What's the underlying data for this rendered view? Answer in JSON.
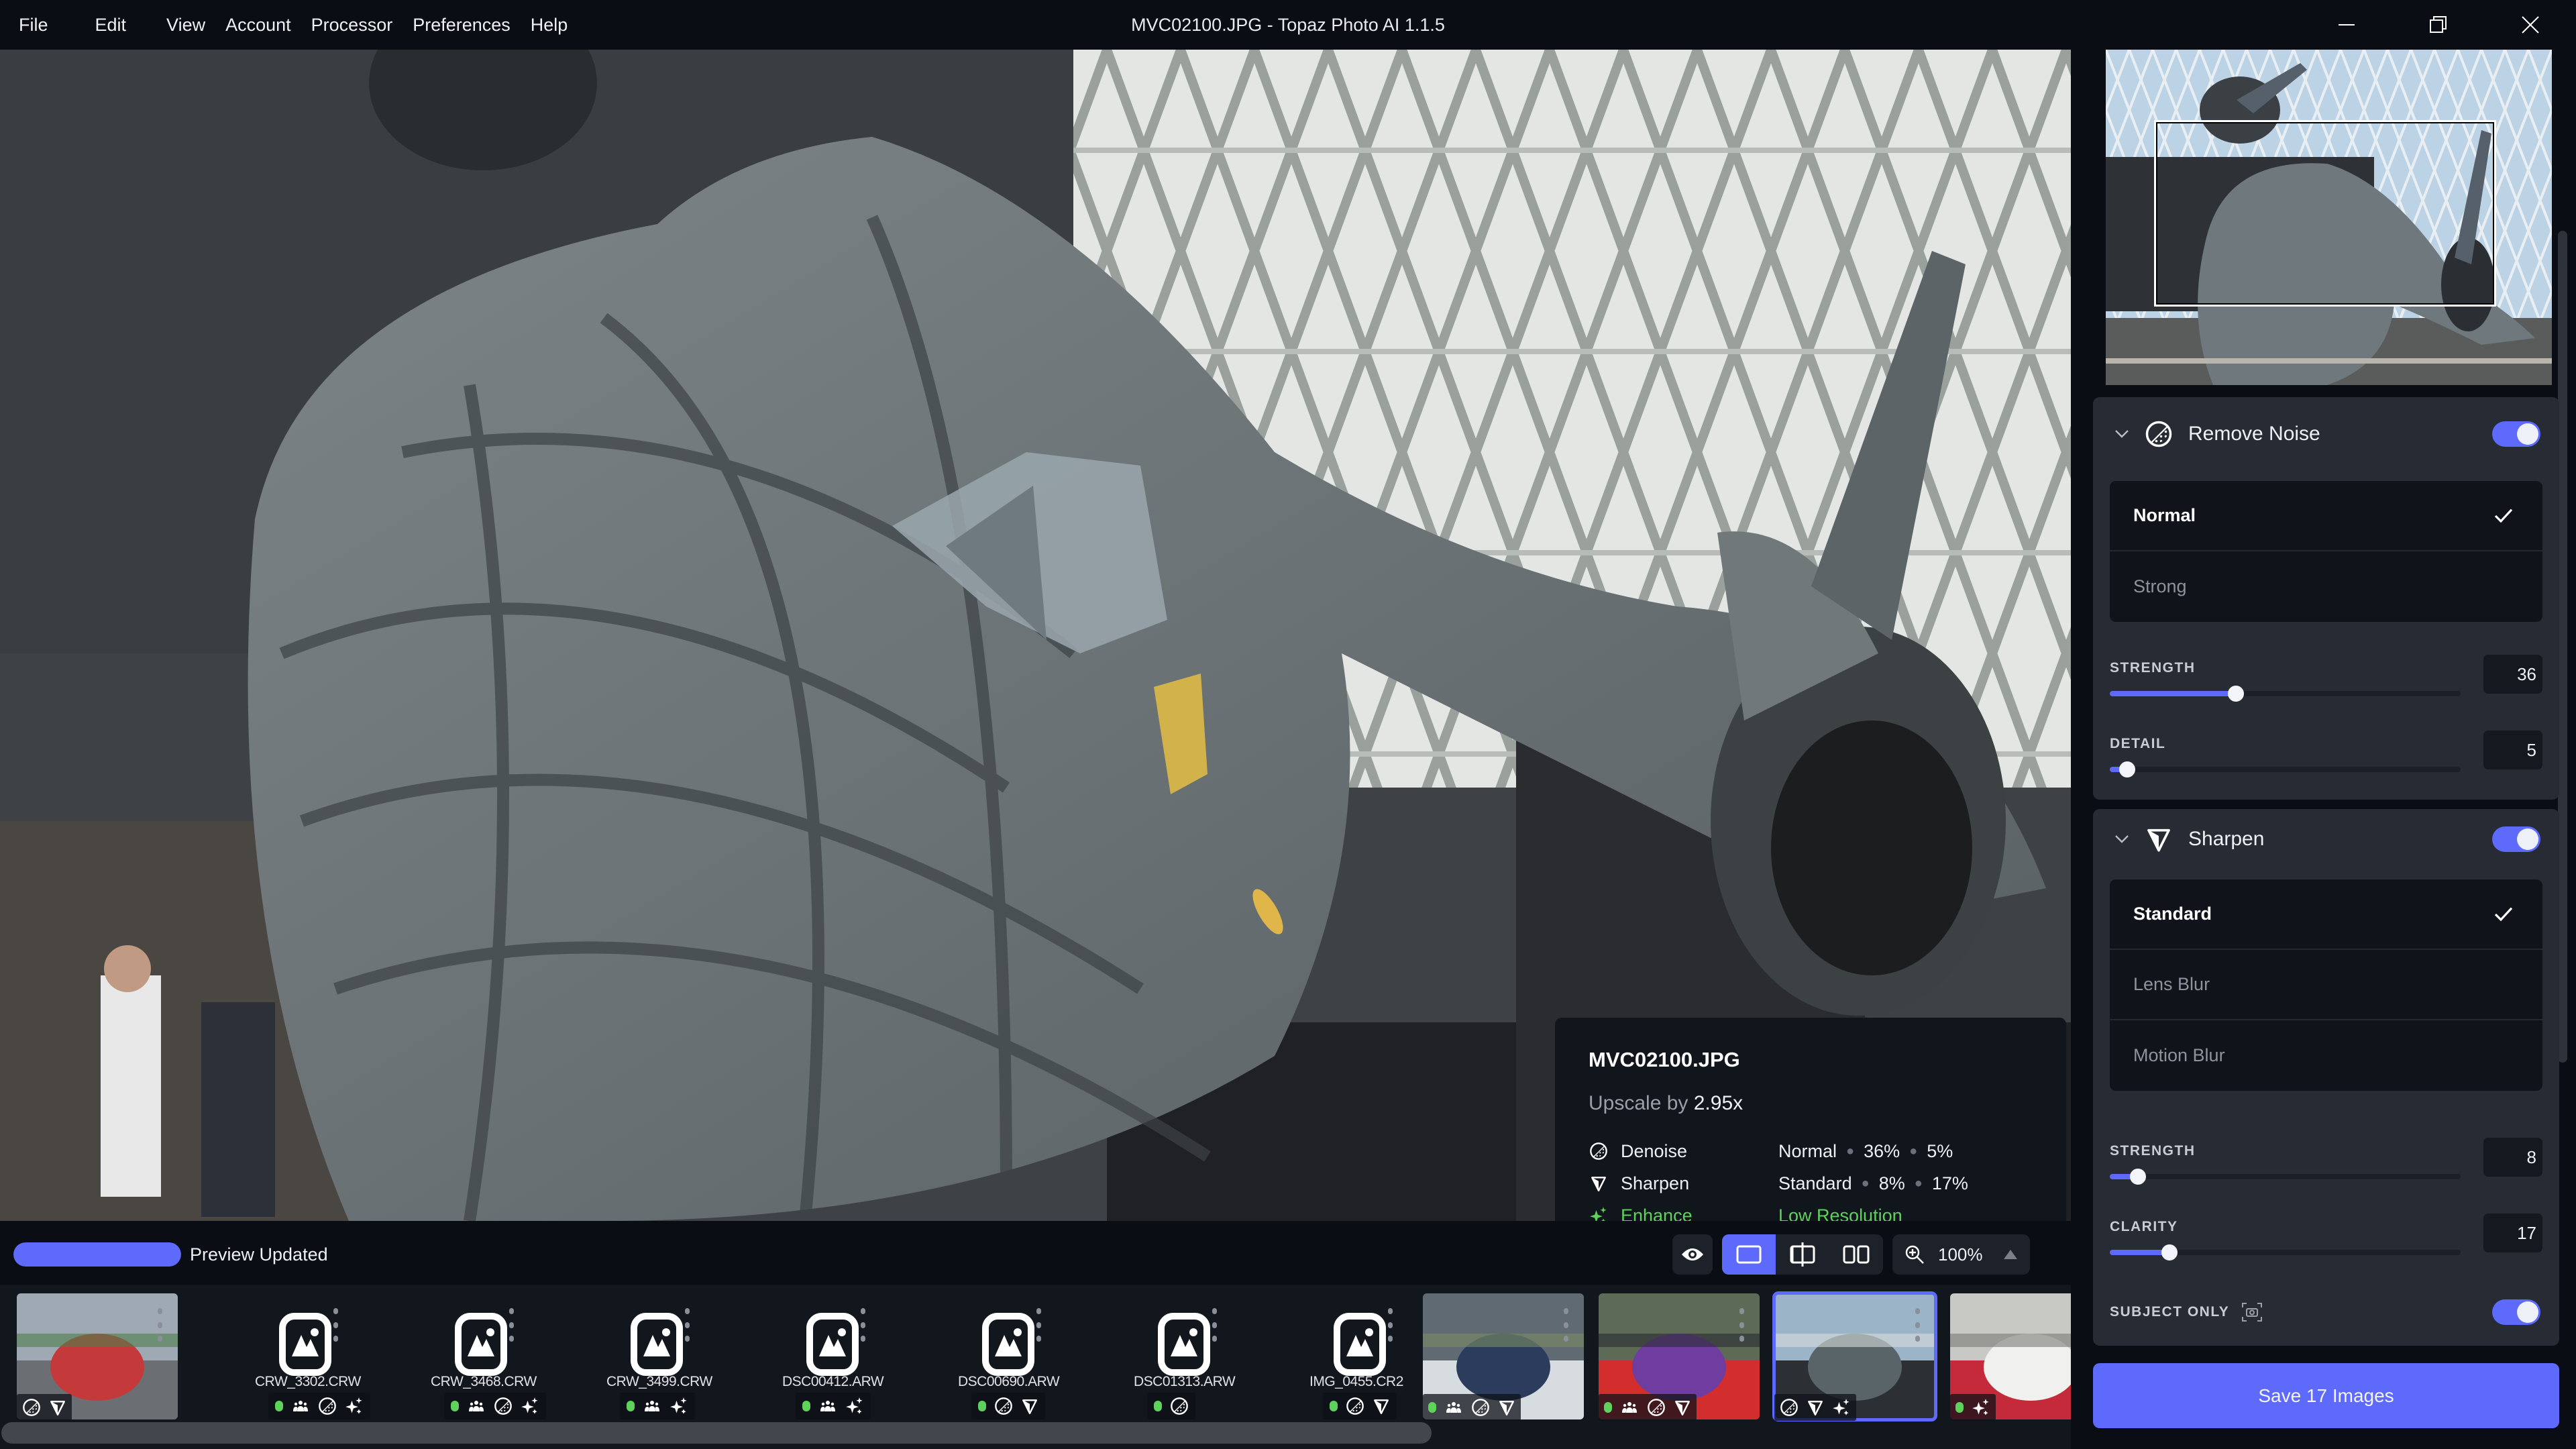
{
  "titlebar": {
    "menu": [
      "File",
      "Edit",
      "View",
      "Account",
      "Processor",
      "Preferences",
      "Help"
    ],
    "title": "MVC02100.JPG - Topaz Photo AI 1.1.5",
    "controls": [
      "minimize-icon",
      "restore-icon",
      "close-icon"
    ]
  },
  "info_card": {
    "filename": "MVC02100.JPG",
    "upscale_label": "Upscale by",
    "upscale_value": "2.95x",
    "rows": [
      {
        "icon": "denoise-icon",
        "label": "Denoise",
        "values": [
          "Normal",
          "36%",
          "5%"
        ],
        "color": "#eef0f4"
      },
      {
        "icon": "sharpen-icon",
        "label": "Sharpen",
        "values": [
          "Standard",
          "8%",
          "17%"
        ],
        "color": "#eef0f4"
      },
      {
        "icon": "enhance-icon",
        "label": "Enhance",
        "values": [
          "Low Resolution"
        ],
        "color": "#5ed25a"
      }
    ]
  },
  "statusbar": {
    "progress": 1.0,
    "status_text": "Preview Updated",
    "view_modes": [
      "single-view-icon",
      "split-view-icon",
      "side-by-side-icon"
    ],
    "active_view": "single-view-icon",
    "zoom": "100%"
  },
  "filmstrip": {
    "items": [
      {
        "type": "image",
        "name": "",
        "scene": "racetrack",
        "badges": [
          "denoise-icon",
          "sharpen-icon"
        ],
        "status": false
      },
      {
        "type": "placeholder",
        "name": "CRW_3302.CRW",
        "badges": [
          "face-icon",
          "denoise-icon",
          "enhance-icon"
        ],
        "status": true
      },
      {
        "type": "placeholder",
        "name": "CRW_3468.CRW",
        "badges": [
          "face-icon",
          "denoise-icon",
          "enhance-icon"
        ],
        "status": true
      },
      {
        "type": "placeholder",
        "name": "CRW_3499.CRW",
        "badges": [
          "face-icon",
          "enhance-icon"
        ],
        "status": true
      },
      {
        "type": "placeholder",
        "name": "DSC00412.ARW",
        "badges": [
          "face-icon",
          "enhance-icon"
        ],
        "status": true
      },
      {
        "type": "placeholder",
        "name": "DSC00690.ARW",
        "badges": [
          "denoise-icon",
          "sharpen-icon"
        ],
        "status": true
      },
      {
        "type": "placeholder",
        "name": "DSC01313.ARW",
        "badges": [
          "denoise-icon"
        ],
        "status": true
      },
      {
        "type": "placeholder",
        "name": "IMG_0455.CR2",
        "badges": [
          "denoise-icon",
          "sharpen-icon"
        ],
        "status": true
      },
      {
        "type": "image",
        "name": "",
        "scene": "cyclists1",
        "badges": [
          "face-icon",
          "denoise-icon",
          "sharpen-icon"
        ],
        "status": true
      },
      {
        "type": "image",
        "name": "",
        "scene": "cyclists2",
        "badges": [
          "face-icon",
          "denoise-icon",
          "sharpen-icon"
        ],
        "status": true
      },
      {
        "type": "image",
        "name": "",
        "scene": "jet",
        "badges": [
          "denoise-icon",
          "sharpen-icon",
          "enhance-icon"
        ],
        "status": false,
        "selected": true
      },
      {
        "type": "image",
        "name": "",
        "scene": "airliner",
        "badges": [
          "enhance-icon"
        ],
        "status": true
      }
    ]
  },
  "panel": {
    "remove_noise": {
      "title": "Remove Noise",
      "enabled": true,
      "options": [
        "Normal",
        "Strong"
      ],
      "selected": "Normal",
      "sliders": [
        {
          "label": "STRENGTH",
          "value": 36,
          "max": 100
        },
        {
          "label": "DETAIL",
          "value": 5,
          "max": 100
        }
      ]
    },
    "sharpen": {
      "title": "Sharpen",
      "enabled": true,
      "options": [
        "Standard",
        "Lens Blur",
        "Motion Blur"
      ],
      "selected": "Standard",
      "sliders": [
        {
          "label": "STRENGTH",
          "value": 8,
          "max": 100
        },
        {
          "label": "CLARITY",
          "value": 17,
          "max": 100
        }
      ],
      "subject_only_label": "SUBJECT ONLY",
      "subject_only": true
    },
    "save_label": "Save 17 Images"
  },
  "colors": {
    "accent": "#5e6afc",
    "success": "#5ed25a",
    "background": "#0a0d13",
    "card": "#272b33"
  }
}
